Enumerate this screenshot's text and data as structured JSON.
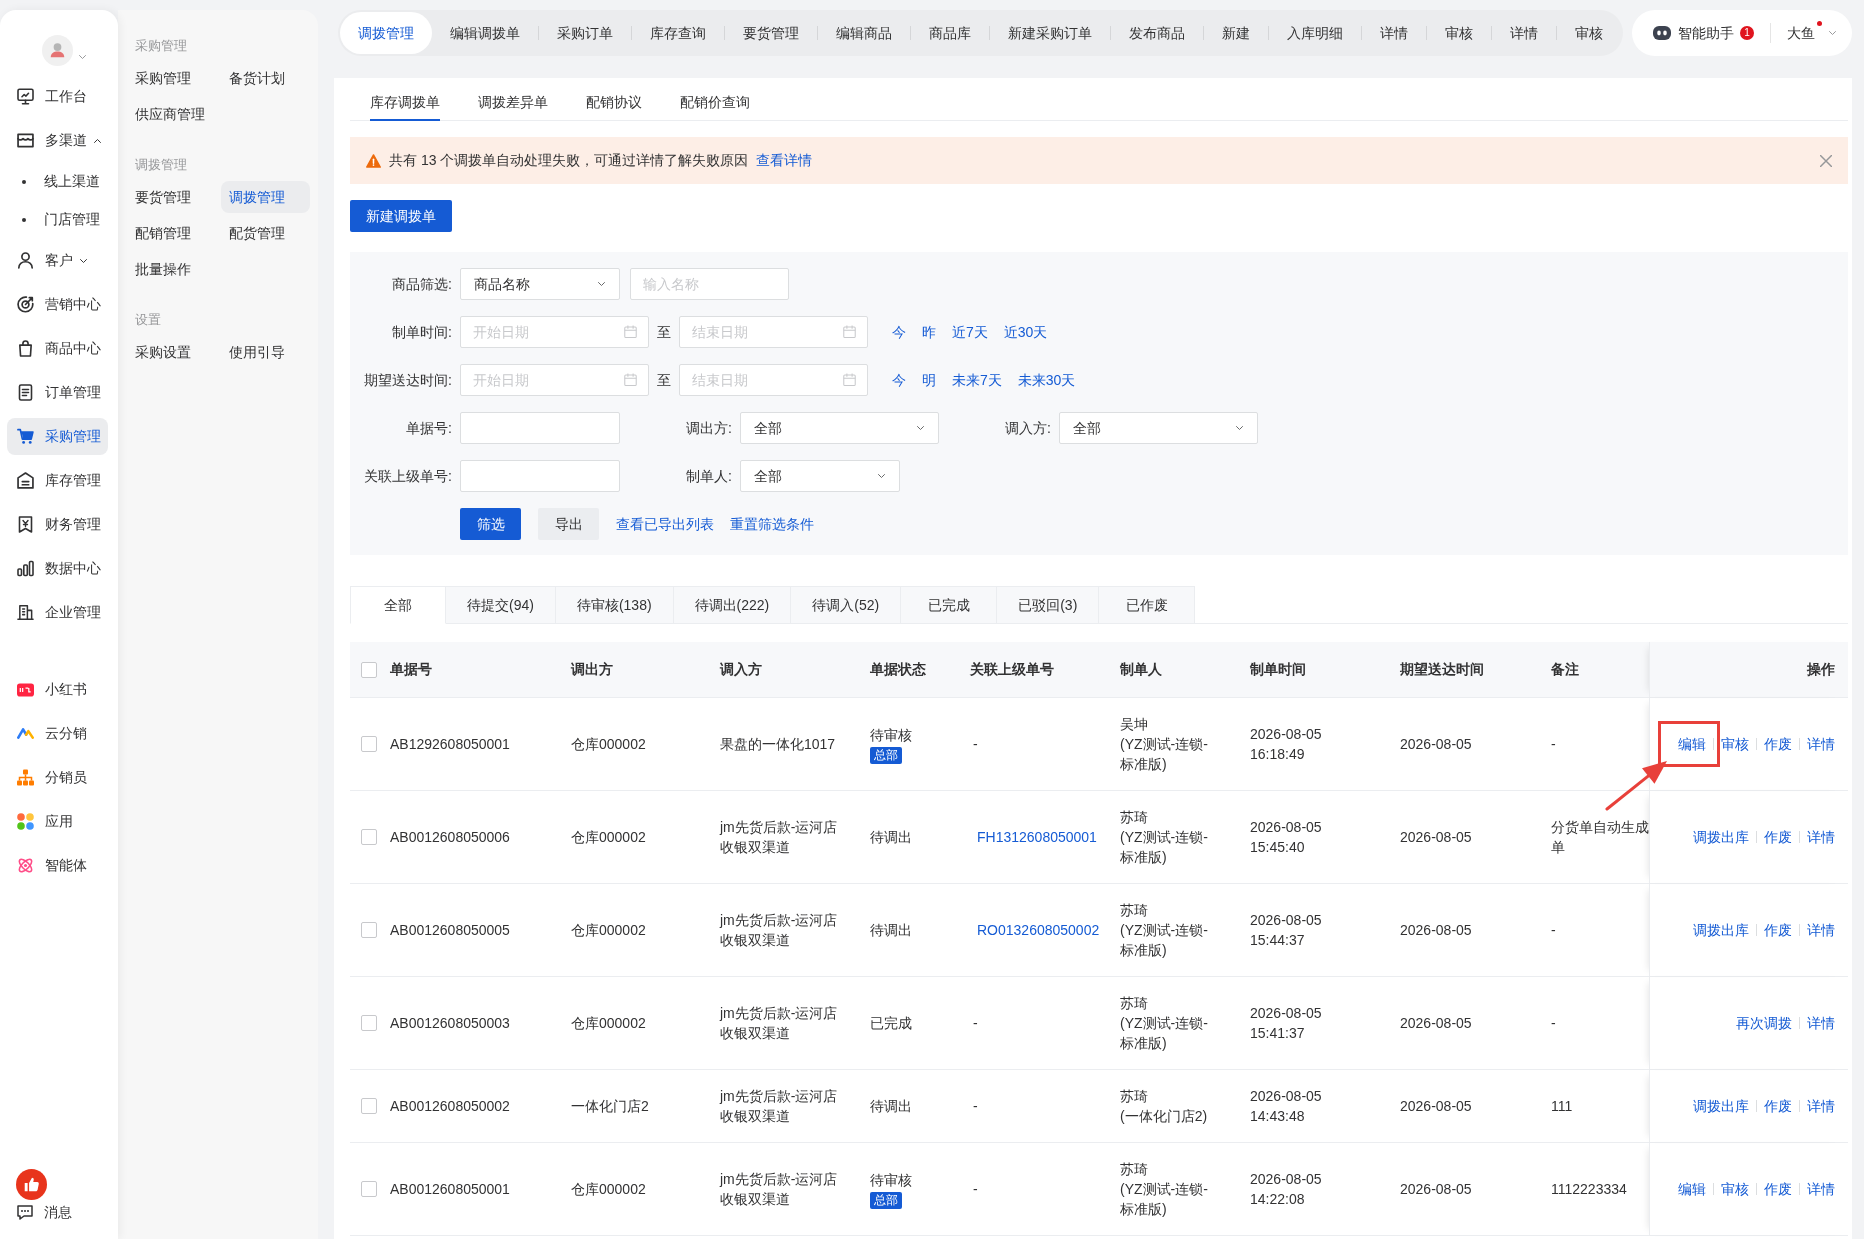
{
  "sidebar": {
    "items": [
      {
        "label": "工作台",
        "kind": "link",
        "selected": false
      },
      {
        "label": "多渠道",
        "kind": "group",
        "selected": false,
        "expanded": true,
        "children": [
          {
            "label": "线上渠道",
            "selected": false
          },
          {
            "label": "门店管理",
            "selected": false
          }
        ]
      },
      {
        "label": "客户",
        "kind": "group",
        "selected": false,
        "expanded": false
      },
      {
        "label": "营销中心",
        "kind": "link",
        "selected": false
      },
      {
        "label": "商品中心",
        "kind": "link",
        "selected": false
      },
      {
        "label": "订单管理",
        "kind": "link",
        "selected": false
      },
      {
        "label": "采购管理",
        "kind": "link",
        "selected": true
      },
      {
        "label": "库存管理",
        "kind": "link",
        "selected": false
      },
      {
        "label": "财务管理",
        "kind": "link",
        "selected": false
      },
      {
        "label": "数据中心",
        "kind": "link",
        "selected": false
      },
      {
        "label": "企业管理",
        "kind": "link",
        "selected": false
      }
    ],
    "apps": [
      {
        "label": "小红书",
        "selected": false
      },
      {
        "label": "云分销",
        "selected": false
      },
      {
        "label": "分销员",
        "selected": false
      },
      {
        "label": "应用",
        "selected": false
      },
      {
        "label": "智能体",
        "selected": false
      }
    ],
    "messages": {
      "label": "消息",
      "selected": false
    }
  },
  "submenu": {
    "sections": [
      {
        "title": "采购管理",
        "items": [
          {
            "label": "采购管理",
            "selected": false
          },
          {
            "label": "备货计划",
            "selected": false
          },
          {
            "label": "供应商管理",
            "selected": false
          }
        ]
      },
      {
        "title": "调拨管理",
        "items": [
          {
            "label": "要货管理",
            "selected": false
          },
          {
            "label": "调拨管理",
            "selected": true
          },
          {
            "label": "配销管理",
            "selected": false
          },
          {
            "label": "配货管理",
            "selected": false
          },
          {
            "label": "批量操作",
            "selected": false
          }
        ]
      },
      {
        "title": "设置",
        "items": [
          {
            "label": "采购设置",
            "selected": false
          },
          {
            "label": "使用引导",
            "selected": false
          }
        ]
      }
    ]
  },
  "top_tabs": [
    {
      "label": "调拨管理",
      "selected": true
    },
    {
      "label": "编辑调拨单",
      "selected": false
    },
    {
      "label": "采购订单",
      "selected": false
    },
    {
      "label": "库存查询",
      "selected": false
    },
    {
      "label": "要货管理",
      "selected": false
    },
    {
      "label": "编辑商品",
      "selected": false
    },
    {
      "label": "商品库",
      "selected": false
    },
    {
      "label": "新建采购订单",
      "selected": false
    },
    {
      "label": "发布商品",
      "selected": false
    },
    {
      "label": "新建",
      "selected": false
    },
    {
      "label": "入库明细",
      "selected": false
    },
    {
      "label": "详情",
      "selected": false
    },
    {
      "label": "审核",
      "selected": false
    },
    {
      "label": "详情",
      "selected": false
    },
    {
      "label": "审核",
      "selected": false
    }
  ],
  "assistant": {
    "label": "智能助手",
    "badge": "1"
  },
  "user": {
    "name": "大鱼",
    "unread": true
  },
  "sub_tabs": [
    {
      "label": "库存调拨单",
      "selected": true
    },
    {
      "label": "调拨差异单",
      "selected": false
    },
    {
      "label": "配销协议",
      "selected": false
    },
    {
      "label": "配销价查询",
      "selected": false
    }
  ],
  "alert": {
    "text": "共有 13 个调拨单自动处理失败，可通过详情了解失败原因",
    "link": "查看详情"
  },
  "create_button": "新建调拨单",
  "filters": {
    "product": {
      "label": "商品筛选:",
      "select": "商品名称",
      "placeholder": "输入名称"
    },
    "created": {
      "label": "制单时间:",
      "start": {
        "placeholder": "开始日期"
      },
      "separator": "至",
      "end": {
        "placeholder": "结束日期"
      },
      "shortcuts": [
        "今",
        "昨",
        "近7天",
        "近30天"
      ]
    },
    "expected": {
      "label": "期望送达时间:",
      "start": {
        "placeholder": "开始日期"
      },
      "separator": "至",
      "end": {
        "placeholder": "结束日期"
      },
      "shortcuts": [
        "今",
        "明",
        "未来7天",
        "未来30天"
      ]
    },
    "order_no": {
      "label": "单据号:"
    },
    "source": {
      "label": "调出方:",
      "value": "全部"
    },
    "target": {
      "label": "调入方:",
      "value": "全部"
    },
    "parent_no": {
      "label": "关联上级单号:"
    },
    "creator": {
      "label": "制单人:",
      "value": "全部"
    },
    "buttons": [
      {
        "label": "筛选",
        "kind": "primary"
      },
      {
        "label": "导出",
        "kind": "default"
      }
    ],
    "links": [
      "查看已导出列表",
      "重置筛选条件"
    ]
  },
  "status_tabs": [
    {
      "label": "全部",
      "selected": true
    },
    {
      "label": "待提交(94)",
      "selected": false
    },
    {
      "label": "待审核(138)",
      "selected": false
    },
    {
      "label": "待调出(222)",
      "selected": false
    },
    {
      "label": "待调入(52)",
      "selected": false
    },
    {
      "label": "已完成",
      "selected": false
    },
    {
      "label": "已驳回(3)",
      "selected": false
    },
    {
      "label": "已作废",
      "selected": false
    }
  ],
  "table": {
    "select_all": {
      "checked": false
    },
    "columns": [
      "单据号",
      "调出方",
      "调入方",
      "单据状态",
      "关联上级单号",
      "制单人",
      "制单时间",
      "期望送达时间",
      "备注",
      "操作"
    ],
    "rows": [
      {
        "checked": false,
        "order_no": "AB1292608050001",
        "source": "仓库000002",
        "target": "果盘的一体化1017",
        "status": "待审核",
        "tag": "总部",
        "related": {
          "text": "-",
          "kind": "text"
        },
        "creator": {
          "name": "吴坤",
          "org": "(YZ测试-连锁-标准版)"
        },
        "created_at": "2026-08-05 16:18:49",
        "expected": "2026-08-05",
        "remark": "-",
        "actions": [
          {
            "label": "编辑",
            "highlighted": true
          },
          {
            "label": "审核",
            "highlighted": false
          },
          {
            "label": "作废",
            "highlighted": false
          },
          {
            "label": "详情",
            "highlighted": false
          }
        ]
      },
      {
        "checked": false,
        "order_no": "AB0012608050006",
        "source": "仓库000002",
        "target": "jm先货后款-运河店收银双渠道",
        "status": "待调出",
        "related": {
          "text": "FH1312608050001",
          "kind": "link"
        },
        "creator": {
          "name": "苏琦",
          "org": "(YZ测试-连锁-标准版)"
        },
        "created_at": "2026-08-05 15:45:40",
        "expected": "2026-08-05",
        "remark": "分货单自动生成单",
        "actions": [
          {
            "label": "调拨出库",
            "highlighted": false
          },
          {
            "label": "作废",
            "highlighted": false
          },
          {
            "label": "详情",
            "highlighted": false
          }
        ]
      },
      {
        "checked": false,
        "order_no": "AB0012608050005",
        "source": "仓库000002",
        "target": "jm先货后款-运河店收银双渠道",
        "status": "待调出",
        "related": {
          "text": "RO0132608050002",
          "kind": "link"
        },
        "creator": {
          "name": "苏琦",
          "org": "(YZ测试-连锁-标准版)"
        },
        "created_at": "2026-08-05 15:44:37",
        "expected": "2026-08-05",
        "remark": "-",
        "actions": [
          {
            "label": "调拨出库",
            "highlighted": false
          },
          {
            "label": "作废",
            "highlighted": false
          },
          {
            "label": "详情",
            "highlighted": false
          }
        ]
      },
      {
        "checked": false,
        "order_no": "AB0012608050003",
        "source": "仓库000002",
        "target": "jm先货后款-运河店收银双渠道",
        "status": "已完成",
        "related": {
          "text": "-",
          "kind": "text"
        },
        "creator": {
          "name": "苏琦",
          "org": "(YZ测试-连锁-标准版)"
        },
        "created_at": "2026-08-05 15:41:37",
        "expected": "2026-08-05",
        "remark": "-",
        "actions": [
          {
            "label": "再次调拨",
            "highlighted": false
          },
          {
            "label": "详情",
            "highlighted": false
          }
        ]
      },
      {
        "checked": false,
        "order_no": "AB0012608050002",
        "source": "一体化门店2",
        "target": "jm先货后款-运河店收银双渠道",
        "status": "待调出",
        "related": {
          "text": "-",
          "kind": "text"
        },
        "creator": {
          "name": "苏琦",
          "org": "(一体化门店2)"
        },
        "created_at": "2026-08-05 14:43:48",
        "expected": "2026-08-05",
        "remark": "111",
        "actions": [
          {
            "label": "调拨出库",
            "highlighted": false
          },
          {
            "label": "作废",
            "highlighted": false
          },
          {
            "label": "详情",
            "highlighted": false
          }
        ]
      },
      {
        "checked": false,
        "order_no": "AB0012608050001",
        "source": "仓库000002",
        "target": "jm先货后款-运河店收银双渠道",
        "status": "待审核",
        "tag": "总部",
        "related": {
          "text": "-",
          "kind": "text"
        },
        "creator": {
          "name": "苏琦",
          "org": "(YZ测试-连锁-标准版)"
        },
        "created_at": "2026-08-05 14:22:08",
        "expected": "2026-08-05",
        "remark": "1112223334",
        "actions": [
          {
            "label": "编辑",
            "highlighted": false
          },
          {
            "label": "审核",
            "highlighted": false
          },
          {
            "label": "作废",
            "highlighted": false
          },
          {
            "label": "详情",
            "highlighted": false
          }
        ]
      }
    ]
  }
}
